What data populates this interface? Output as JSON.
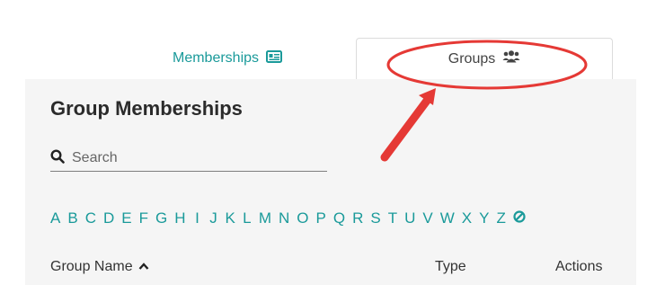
{
  "tabs": {
    "memberships": {
      "label": "Memberships",
      "icon": "id-card-icon"
    },
    "groups": {
      "label": "Groups",
      "icon": "users-icon"
    }
  },
  "page": {
    "title": "Group Memberships"
  },
  "search": {
    "placeholder": "Search",
    "value": ""
  },
  "alphabet": {
    "letters": [
      "A",
      "B",
      "C",
      "D",
      "E",
      "F",
      "G",
      "H",
      "I",
      "J",
      "K",
      "L",
      "M",
      "N",
      "O",
      "P",
      "Q",
      "R",
      "S",
      "T",
      "U",
      "V",
      "W",
      "X",
      "Y",
      "Z"
    ],
    "clear_icon": "ban-icon"
  },
  "table": {
    "columns": {
      "name": "Group Name",
      "type": "Type",
      "actions": "Actions"
    },
    "sort_icon": "chevron-up-icon"
  },
  "colors": {
    "accent": "#1a9a9a",
    "annotation": "#e53935",
    "panel_bg": "#f5f5f5"
  }
}
